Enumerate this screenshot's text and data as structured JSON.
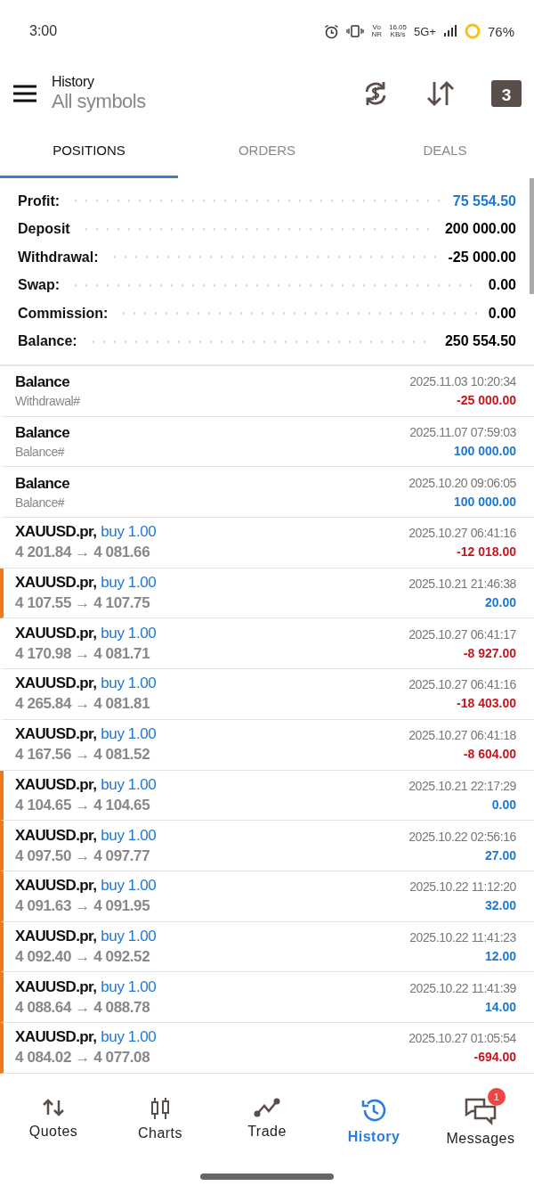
{
  "status_bar": {
    "time": "3:00",
    "volte": [
      "Vo",
      "NR"
    ],
    "speed": [
      "16.05",
      "KB/s"
    ],
    "network": "5G+",
    "battery": "76%"
  },
  "header": {
    "title": "History",
    "subtitle": "All symbols",
    "calendar_day": "3"
  },
  "tabs": [
    {
      "label": "POSITIONS",
      "selected": true
    },
    {
      "label": "ORDERS",
      "selected": false
    },
    {
      "label": "DEALS",
      "selected": false
    }
  ],
  "summary": [
    {
      "label": "Profit:",
      "value": "75 554.50",
      "color": "#1e78d2"
    },
    {
      "label": "Deposit",
      "value": "200 000.00",
      "color": "#000000"
    },
    {
      "label": "Withdrawal:",
      "value": "-25 000.00",
      "color": "#000000"
    },
    {
      "label": "Swap:",
      "value": "0.00",
      "color": "#000000"
    },
    {
      "label": "Commission:",
      "value": "0.00",
      "color": "#000000"
    },
    {
      "label": "Balance:",
      "value": "250 554.50",
      "color": "#000000"
    }
  ],
  "rows": [
    {
      "kind": "balance",
      "title": "Balance",
      "detail": "Withdrawal#",
      "time": "2025.11.03 10:20:34",
      "amount": "-25 000.00",
      "color": "#c8141e",
      "flagged": false
    },
    {
      "kind": "balance",
      "title": "Balance",
      "detail": "Balance#",
      "time": "2025.11.07 07:59:03",
      "amount": "100 000.00",
      "color": "#1e78d2",
      "flagged": false
    },
    {
      "kind": "balance",
      "title": "Balance",
      "detail": "Balance#",
      "time": "2025.10.20 09:06:05",
      "amount": "100 000.00",
      "color": "#1e78d2",
      "flagged": false
    },
    {
      "kind": "trade",
      "title": "XAUUSD.pr,",
      "side": "buy 1.00",
      "detail": "4 201.84 → 4 081.66",
      "time": "2025.10.27 06:41:16",
      "amount": "-12 018.00",
      "color": "#c8141e",
      "flagged": false
    },
    {
      "kind": "trade",
      "title": "XAUUSD.pr,",
      "side": "buy 1.00",
      "detail": "4 107.55 → 4 107.75",
      "time": "2025.10.21 21:46:38",
      "amount": "20.00",
      "color": "#1e78d2",
      "flagged": true
    },
    {
      "kind": "trade",
      "title": "XAUUSD.pr,",
      "side": "buy 1.00",
      "detail": "4 170.98 → 4 081.71",
      "time": "2025.10.27 06:41:17",
      "amount": "-8 927.00",
      "color": "#c8141e",
      "flagged": false
    },
    {
      "kind": "trade",
      "title": "XAUUSD.pr,",
      "side": "buy 1.00",
      "detail": "4 265.84 → 4 081.81",
      "time": "2025.10.27 06:41:16",
      "amount": "-18 403.00",
      "color": "#c8141e",
      "flagged": false
    },
    {
      "kind": "trade",
      "title": "XAUUSD.pr,",
      "side": "buy 1.00",
      "detail": "4 167.56 → 4 081.52",
      "time": "2025.10.27 06:41:18",
      "amount": "-8 604.00",
      "color": "#c8141e",
      "flagged": false
    },
    {
      "kind": "trade",
      "title": "XAUUSD.pr,",
      "side": "buy 1.00",
      "detail": "4 104.65 → 4 104.65",
      "time": "2025.10.21 22:17:29",
      "amount": "0.00",
      "color": "#1e78d2",
      "flagged": true
    },
    {
      "kind": "trade",
      "title": "XAUUSD.pr,",
      "side": "buy 1.00",
      "detail": "4 097.50 → 4 097.77",
      "time": "2025.10.22 02:56:16",
      "amount": "27.00",
      "color": "#1e78d2",
      "flagged": true
    },
    {
      "kind": "trade",
      "title": "XAUUSD.pr,",
      "side": "buy 1.00",
      "detail": "4 091.63 → 4 091.95",
      "time": "2025.10.22 11:12:20",
      "amount": "32.00",
      "color": "#1e78d2",
      "flagged": true
    },
    {
      "kind": "trade",
      "title": "XAUUSD.pr,",
      "side": "buy 1.00",
      "detail": "4 092.40 → 4 092.52",
      "time": "2025.10.22 11:41:23",
      "amount": "12.00",
      "color": "#1e78d2",
      "flagged": true
    },
    {
      "kind": "trade",
      "title": "XAUUSD.pr,",
      "side": "buy 1.00",
      "detail": "4 088.64 → 4 088.78",
      "time": "2025.10.22 11:41:39",
      "amount": "14.00",
      "color": "#1e78d2",
      "flagged": true
    },
    {
      "kind": "trade",
      "title": "XAUUSD.pr,",
      "side": "buy 1.00",
      "detail": "4 084.02 → 4 077.08",
      "time": "2025.10.27 01:05:54",
      "amount": "-694.00",
      "color": "#c8141e",
      "flagged": true
    }
  ],
  "nav": [
    {
      "label": "Quotes",
      "kind": "quotes",
      "selected": false
    },
    {
      "label": "Charts",
      "kind": "charts",
      "selected": false
    },
    {
      "label": "Trade",
      "kind": "trade",
      "selected": false
    },
    {
      "label": "History",
      "kind": "history",
      "selected": true
    },
    {
      "label": "Messages",
      "kind": "messages",
      "selected": false,
      "badge": "1"
    }
  ]
}
